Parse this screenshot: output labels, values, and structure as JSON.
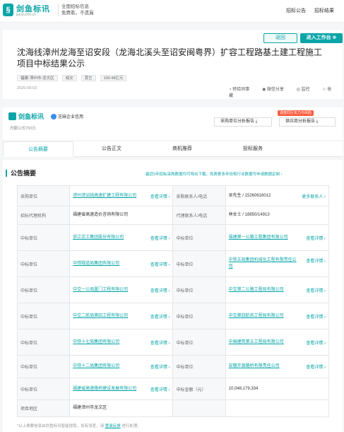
{
  "header": {
    "logo_mark": "§",
    "logo_name": "剑鱼标讯",
    "logo_domain": "jianyu360.cn",
    "slogan_line1": "全国招标信息",
    "slogan_line2": "免费看，不遗漏",
    "nav": [
      "招标公告",
      "招标结果"
    ]
  },
  "title_card": {
    "back_label": "返回",
    "workbench_label": "进入工作台 ⊕",
    "title": "沈海线漳州龙海至诏安段（龙海北溪头至诏安闽粤界）扩容工程路基土建工程施工项目中标结果公示",
    "tags": [
      "福建-漳州市-龙文区",
      "成交",
      "其它",
      "100.48亿元"
    ],
    "date": "2025-09-03",
    "actions": [
      "转给同事",
      "微信分享",
      "监控",
      "收藏"
    ]
  },
  "company_card": {
    "logo": "剑鱼标讯",
    "partner": "芝麻企业信用",
    "established": "总额公式700元",
    "hot_badge": "调查同行实力与风险",
    "report_a": "采购单位分析报告 ⤓",
    "report_b": "供应商分析报告 ⤓"
  },
  "tabs": [
    "公告摘要",
    "公告正文",
    "商机推荐",
    "投标服务"
  ],
  "summary": {
    "title": "公告摘要",
    "notice": "最近5年招标采购数据均可导出下载，免费更多年份和行业数据可申请数据定制 ›",
    "detail_label": "查看详情 ›",
    "more_contacts": "更多联系人 ›",
    "rows": [
      {
        "l1": "采购单位",
        "v1": "漳州漳诏线高速扩建工程有限公司",
        "link1": true,
        "more1": "detail",
        "l2": "采购联系人/电话",
        "v2": "吴先生 / 15260616012",
        "link2": false,
        "more2": "contacts",
        "h": 29
      },
      {
        "l1": "招标代理机构",
        "v1": "福建省高速造价咨询有限公司",
        "link1": false,
        "more1": "",
        "l2": "代理联系人/电话",
        "v2": "林女士 / 18850/14913",
        "link2": false,
        "more2": "",
        "h": 26
      },
      {
        "l1": "中标单位",
        "v1": "浙江交工集团股份有限公司",
        "link1": true,
        "more1": "detail",
        "l2": "中标单位",
        "v2": "福建第一公路工程集团有限公司",
        "link2": true,
        "more2": "detail",
        "h": 37
      },
      {
        "l1": "中标单位",
        "v1": "中铁隧道局集团有限公司",
        "link1": true,
        "more1": "detail",
        "l2": "中标单位",
        "v2": "中铁五局集团机械化工程有限责任公司",
        "link2": true,
        "more2": "detail",
        "h": 37
      },
      {
        "l1": "中标单位",
        "v1": "中交一公局厦门工程有限公司",
        "link1": true,
        "more1": "detail",
        "l2": "中标单位",
        "v2": "中交第二公路工程局有限公司",
        "link2": true,
        "more2": "detail",
        "h": 37
      },
      {
        "l1": "中标单位",
        "v1": "中交二航局第四工程有限公司",
        "link1": true,
        "more1": "detail",
        "l2": "中标单位",
        "v2": "中交第四航务工程局有限公司",
        "link2": true,
        "more2": "detail",
        "h": 37
      },
      {
        "l1": "中标单位",
        "v1": "中铁十七局集团有限公司",
        "link1": true,
        "more1": "detail",
        "l2": "中标单位",
        "v2": "中国建筑第五工程局有限公司",
        "link2": true,
        "more2": "detail",
        "h": 37
      },
      {
        "l1": "中标单位",
        "v1": "中铁十二局集团有限公司",
        "link1": true,
        "more1": "detail",
        "l2": "中标单位",
        "v2": "安徽开源路桥有限责任公司",
        "link2": true,
        "more2": "detail",
        "h": 32
      },
      {
        "l1": "中标单位",
        "v1": "福建省高速路桥建设发展有限公司",
        "link1": true,
        "more1": "detail",
        "l2": "中标金额（元）",
        "v2": "10,048,179,334",
        "link2": false,
        "more2": "",
        "h": 31
      },
      {
        "l1": "项目地区",
        "v1": "福建漳州市龙文区",
        "link1": false,
        "more1": "",
        "l2": "",
        "v2": "",
        "link2": false,
        "more2": "",
        "h": 24
      }
    ],
    "foot_pre": "*以上摘要信息由剑鱼标讯智能提取，如有误差，请",
    "foot_link": "登录反馈",
    "foot_post": "进行处理。"
  }
}
